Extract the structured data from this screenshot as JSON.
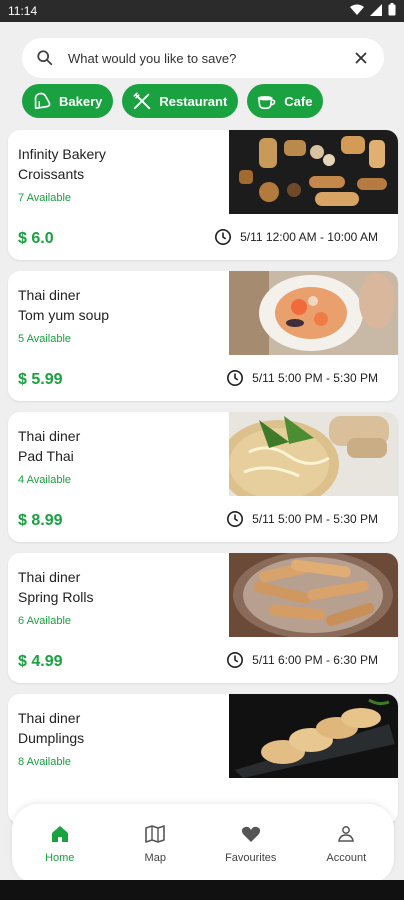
{
  "status": {
    "time": "11:14"
  },
  "search": {
    "placeholder": "What would you like to save?"
  },
  "chips": [
    {
      "label": "Bakery",
      "icon": "bread-icon"
    },
    {
      "label": "Restaurant",
      "icon": "utensils-icon"
    },
    {
      "label": "Cafe",
      "icon": "coffee-cup-icon"
    }
  ],
  "listings": [
    {
      "store": "Infinity Bakery",
      "item": "Croissants",
      "available": "7 Available",
      "price": "$ 6.0",
      "time": "5/11 12:00 AM - 10:00 AM"
    },
    {
      "store": "Thai diner",
      "item": "Tom yum soup",
      "available": "5 Available",
      "price": "$ 5.99",
      "time": "5/11 5:00 PM - 5:30 PM"
    },
    {
      "store": "Thai diner",
      "item": "Pad Thai",
      "available": "4 Available",
      "price": "$ 8.99",
      "time": "5/11 5:00 PM - 5:30 PM"
    },
    {
      "store": "Thai diner",
      "item": "Spring Rolls",
      "available": "6 Available",
      "price": "$ 4.99",
      "time": "5/11 6:00 PM - 6:30 PM"
    },
    {
      "store": "Thai diner",
      "item": "Dumplings",
      "available": "8 Available",
      "price": "",
      "time": ""
    }
  ],
  "nav": {
    "home": "Home",
    "map": "Map",
    "favourites": "Favourites",
    "account": "Account"
  },
  "colors": {
    "accent": "#1aa140",
    "background": "#efefef",
    "card": "#ffffff"
  }
}
